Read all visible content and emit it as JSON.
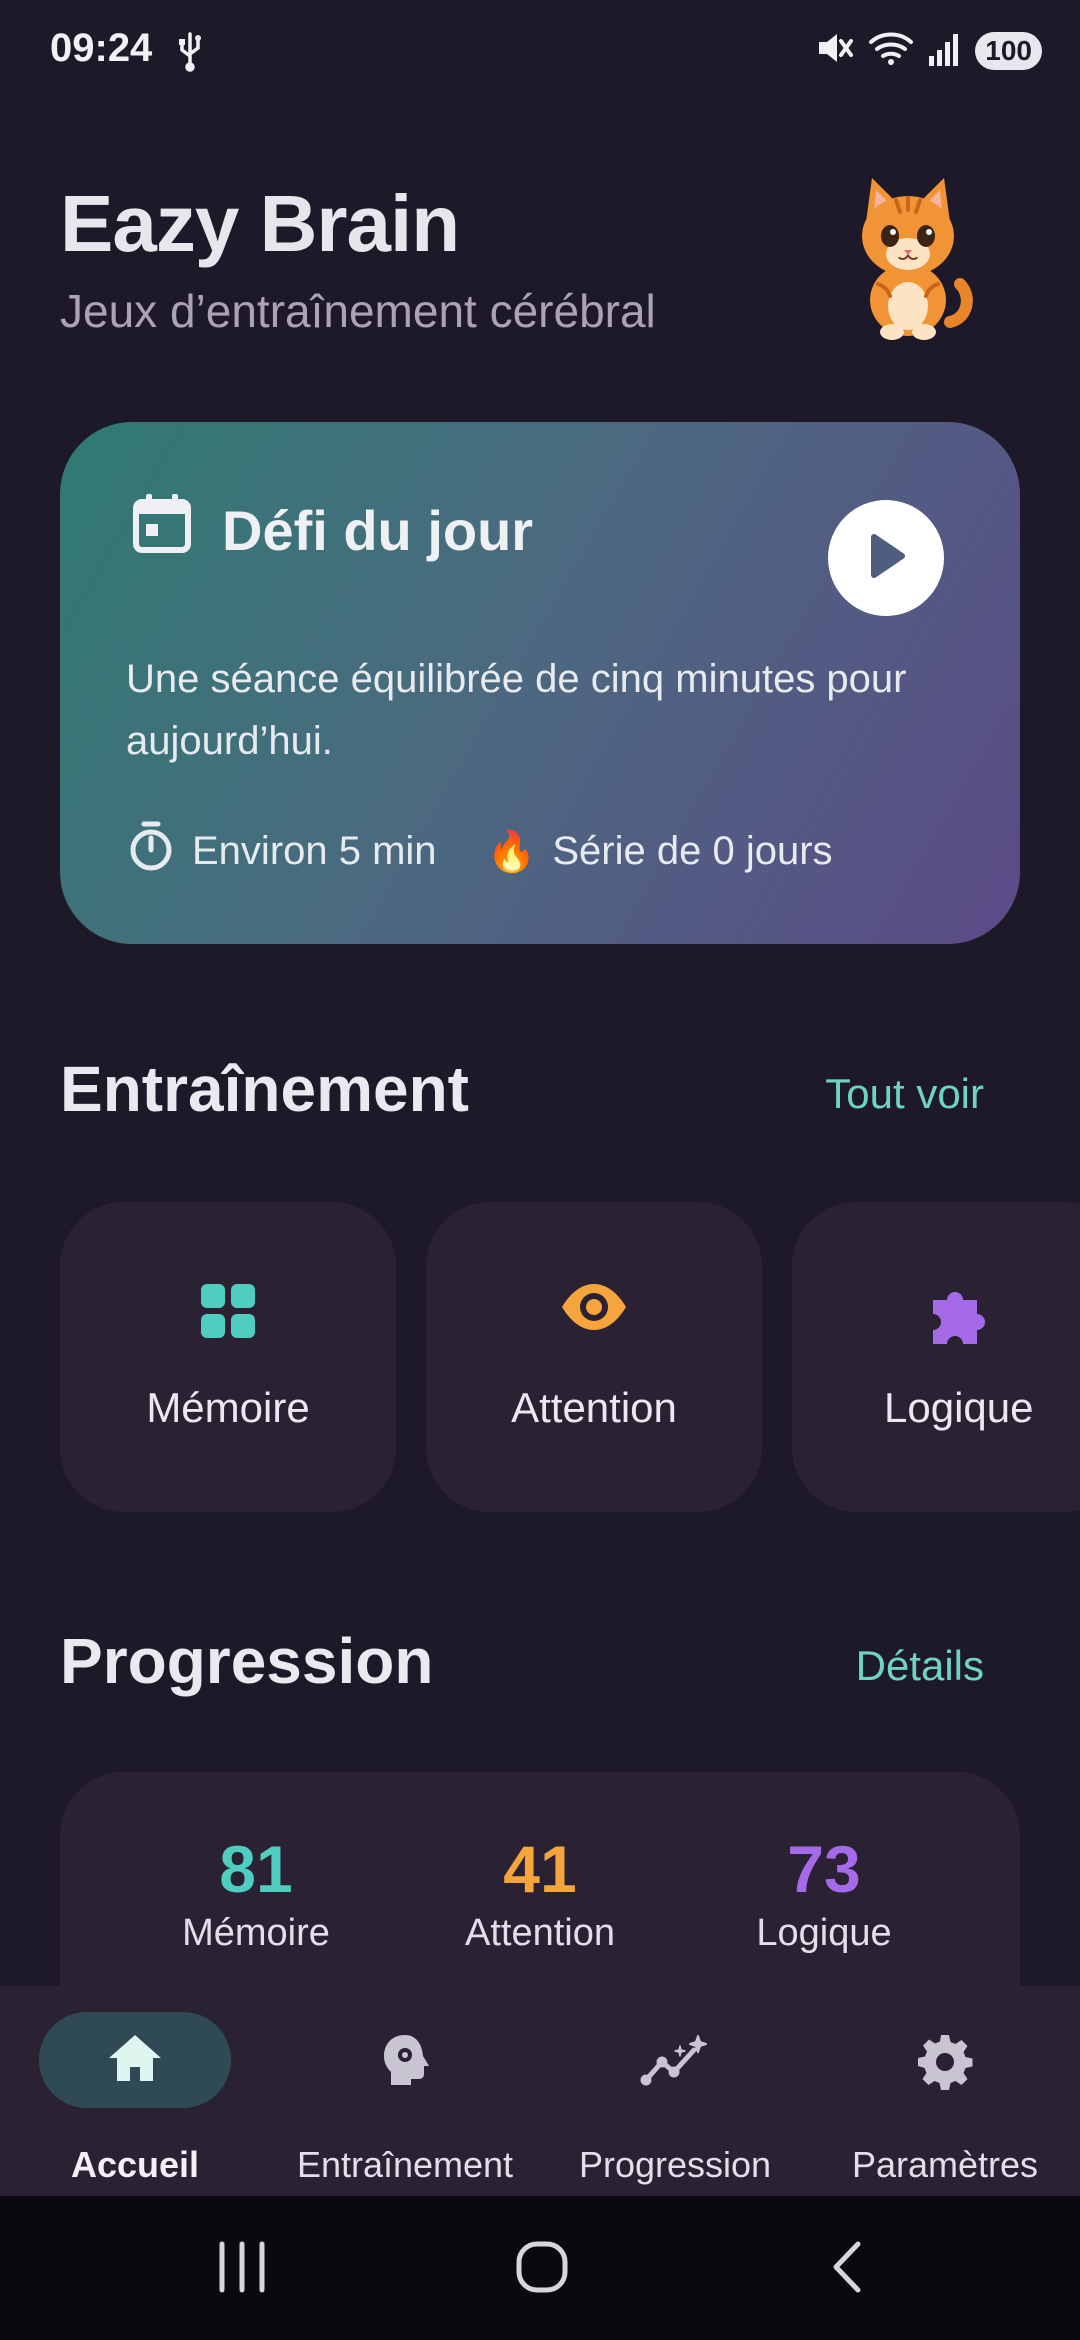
{
  "status_bar": {
    "time": "09:24",
    "battery": "100"
  },
  "header": {
    "title": "Eazy Brain",
    "subtitle": "Jeux d’entraînement cérébral",
    "mascot": "kitten-mascot"
  },
  "daily_challenge": {
    "title": "Défi du jour",
    "description": "Une séance équilibrée de cinq minutes pour aujourd’hui.",
    "duration": "Environ 5 min",
    "streak": "Série de 0 jours",
    "play_icon": "play-icon"
  },
  "training": {
    "title": "Entraînement",
    "see_all": "Tout voir",
    "cards": [
      {
        "label": "Mémoire",
        "icon": "grid-icon",
        "color": "#4ecdc0"
      },
      {
        "label": "Attention",
        "icon": "eye-icon",
        "color": "#f5a53c"
      },
      {
        "label": "Logique",
        "icon": "puzzle-icon",
        "color": "#a56ae8"
      }
    ]
  },
  "progression": {
    "title": "Progression",
    "details": "Détails",
    "stats": [
      {
        "value": "81",
        "label": "Mémoire",
        "color": "#4ecdc0"
      },
      {
        "value": "41",
        "label": "Attention",
        "color": "#f5a53c"
      },
      {
        "value": "73",
        "label": "Logique",
        "color": "#a56ae8"
      }
    ]
  },
  "bottom_nav": {
    "items": [
      {
        "label": "Accueil",
        "icon": "home-icon",
        "active": true
      },
      {
        "label": "Entraînement",
        "icon": "brain-head-icon",
        "active": false
      },
      {
        "label": "Progression",
        "icon": "trend-sparkle-icon",
        "active": false
      },
      {
        "label": "Paramètres",
        "icon": "gear-icon",
        "active": false
      }
    ]
  }
}
